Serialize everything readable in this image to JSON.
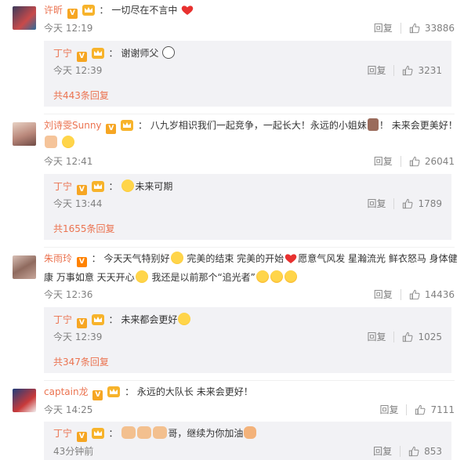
{
  "comments": [
    {
      "name": "许昕",
      "sep": "：",
      "text": "一切尽在不言中",
      "time": "今天 12:19",
      "reply_label": "回复",
      "likes": "33886",
      "reply": {
        "name": "丁宁",
        "sep": "：",
        "text": "谢谢师父",
        "time": "今天 12:39",
        "reply_label": "回复",
        "likes": "3231"
      },
      "more": "共443条回复"
    },
    {
      "name": "刘诗雯Sunny",
      "sep": "：",
      "text": "八九岁相识我们一起竞争，一起长大！永远的小姐妹",
      "text_tail": "！ 未来会更美好！",
      "time": "今天 12:41",
      "reply_label": "回复",
      "likes": "26041",
      "reply": {
        "name": "丁宁",
        "sep": "：",
        "text": "未来可期",
        "time": "今天 13:44",
        "reply_label": "回复",
        "likes": "1789"
      },
      "more": "共1655条回复"
    },
    {
      "name": "朱雨玲",
      "sep": "：",
      "text_a": "今天天气特别好",
      "text_b": "完美的结束 完美的开始",
      "text_c": "愿意气风发 星瀚流光 鲜衣怒马 身体健",
      "text_d": "康 万事如意 天天开心",
      "text_e": " 我还是以前那个“追光者”",
      "time": "今天 12:36",
      "reply_label": "回复",
      "likes": "14436",
      "reply": {
        "name": "丁宁",
        "sep": "：",
        "text": "未来都会更好",
        "time": "今天 12:39",
        "reply_label": "回复",
        "likes": "1025"
      },
      "more": "共347条回复"
    },
    {
      "name": "captain龙",
      "sep": "：",
      "text": "永远的大队长 未来会更好！",
      "time": "今天 14:25",
      "reply_label": "回复",
      "likes": "7111",
      "reply": {
        "name": "丁宁",
        "sep": "：",
        "text_a": "哥，继续为你加油",
        "time": "43分钟前",
        "reply_label": "回复",
        "likes": "853"
      }
    }
  ],
  "icons": {
    "verified": "V",
    "like": "thumbs-up-icon",
    "vip": "crown-icon"
  },
  "colors": {
    "name": "#eb7350",
    "meta": "#808080",
    "reply_bg": "#f2f2f5",
    "badge": "#ff8200"
  }
}
